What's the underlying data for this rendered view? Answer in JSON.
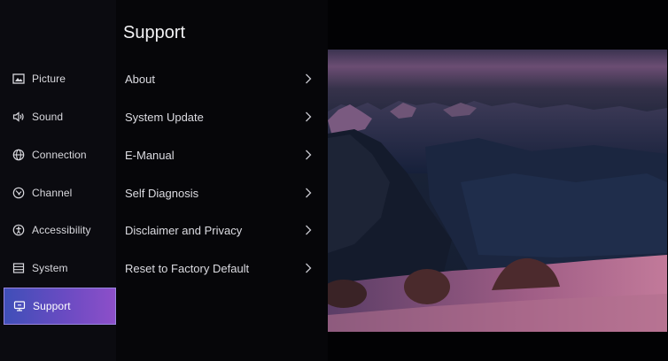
{
  "panel": {
    "title": "Support"
  },
  "sidebar": {
    "items": [
      {
        "label": "Picture",
        "icon": "picture-icon",
        "active": false
      },
      {
        "label": "Sound",
        "icon": "sound-icon",
        "active": false
      },
      {
        "label": "Connection",
        "icon": "globe-icon",
        "active": false
      },
      {
        "label": "Channel",
        "icon": "channel-icon",
        "active": false
      },
      {
        "label": "Accessibility",
        "icon": "accessibility-icon",
        "active": false
      },
      {
        "label": "System",
        "icon": "system-icon",
        "active": false
      },
      {
        "label": "Support",
        "icon": "support-icon",
        "active": true
      }
    ]
  },
  "menu": {
    "items": [
      {
        "label": "About",
        "icon": "chevron-right-icon"
      },
      {
        "label": "System Update",
        "icon": "chevron-right-icon"
      },
      {
        "label": "E-Manual",
        "icon": "chevron-right-icon"
      },
      {
        "label": "Self Diagnosis",
        "icon": "chevron-right-icon"
      },
      {
        "label": "Disclaimer and Privacy",
        "icon": "chevron-right-icon"
      },
      {
        "label": "Reset to Factory Default",
        "icon": "chevron-right-icon"
      }
    ]
  },
  "colors": {
    "active_gradient_start": "#3f4fb8",
    "active_gradient_end": "#8d4fc9",
    "background": "#020204"
  }
}
